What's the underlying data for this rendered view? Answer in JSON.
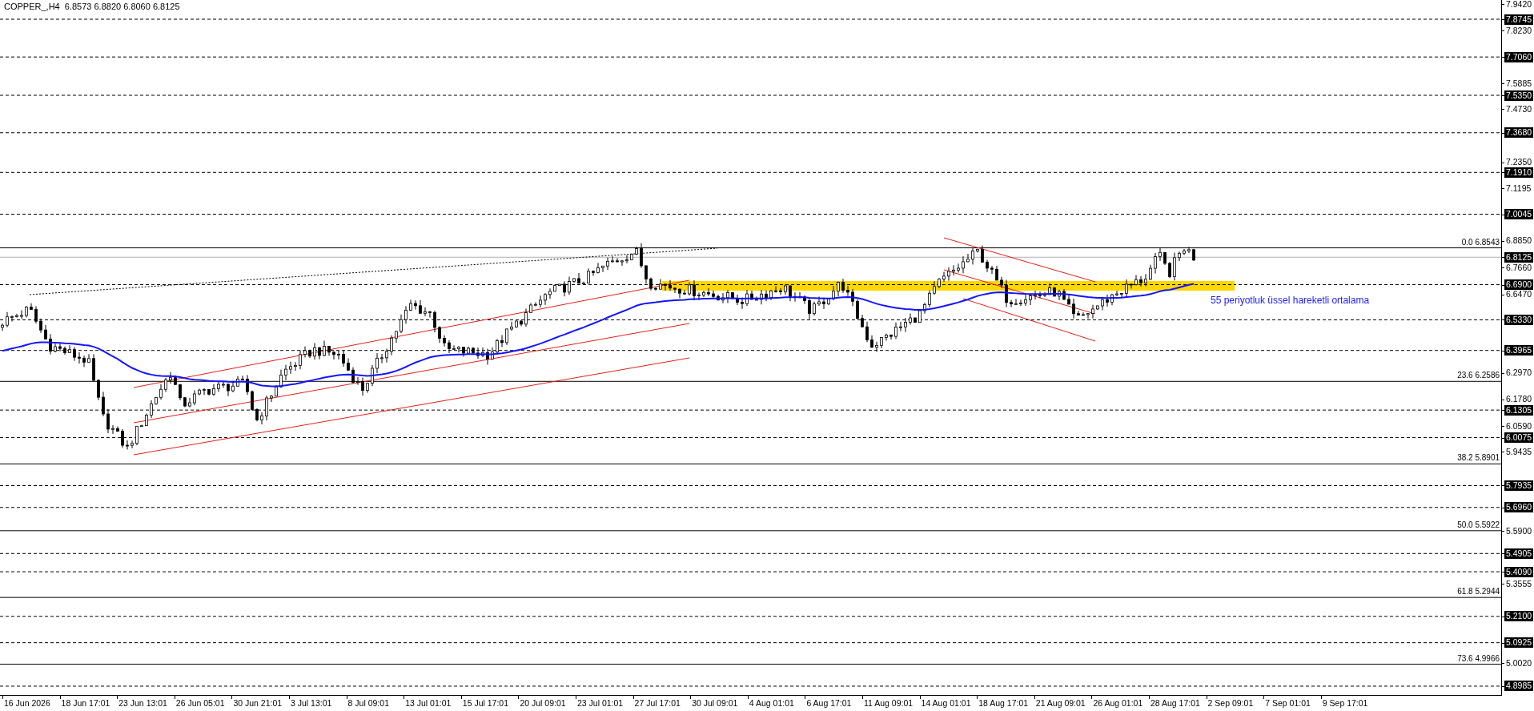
{
  "chart": {
    "title": "COPPER_,H4  6.8573 6.8820 6.8060 6.8125",
    "price_axis": [
      {
        "label": "7.9420",
        "kind": "tick"
      },
      {
        "label": "7.8745",
        "kind": "level"
      },
      {
        "label": "7.8230",
        "kind": "tick"
      },
      {
        "label": "7.7060",
        "kind": "level"
      },
      {
        "label": "7.5885",
        "kind": "tick"
      },
      {
        "label": "7.5350",
        "kind": "level"
      },
      {
        "label": "7.4730",
        "kind": "tick"
      },
      {
        "label": "7.3680",
        "kind": "level"
      },
      {
        "label": "7.2350",
        "kind": "tick"
      },
      {
        "label": "7.1910",
        "kind": "level"
      },
      {
        "label": "7.1195",
        "kind": "tick"
      },
      {
        "label": "7.0045",
        "kind": "level"
      },
      {
        "label": "6.8850",
        "kind": "tick"
      },
      {
        "label": "6.8125",
        "kind": "current"
      },
      {
        "label": "6.7660",
        "kind": "tick"
      },
      {
        "label": "6.6900",
        "kind": "level"
      },
      {
        "label": "6.6470",
        "kind": "tick"
      },
      {
        "label": "6.5330",
        "kind": "level"
      },
      {
        "label": "6.3965",
        "kind": "level"
      },
      {
        "label": "6.2970",
        "kind": "tick"
      },
      {
        "label": "6.1780",
        "kind": "tick"
      },
      {
        "label": "6.1305",
        "kind": "level"
      },
      {
        "label": "6.0590",
        "kind": "tick"
      },
      {
        "label": "6.0075",
        "kind": "level"
      },
      {
        "label": "5.9435",
        "kind": "tick"
      },
      {
        "label": "5.7935",
        "kind": "level"
      },
      {
        "label": "5.6960",
        "kind": "level"
      },
      {
        "label": "5.5900",
        "kind": "tick"
      },
      {
        "label": "5.4905",
        "kind": "level"
      },
      {
        "label": "5.4090",
        "kind": "level"
      },
      {
        "label": "5.3555",
        "kind": "tick"
      },
      {
        "label": "5.2100",
        "kind": "level"
      },
      {
        "label": "5.0925",
        "kind": "level"
      },
      {
        "label": "5.0020",
        "kind": "tick"
      },
      {
        "label": "4.8985",
        "kind": "level"
      }
    ],
    "fib_levels": [
      {
        "label": "0.0 6.8543"
      },
      {
        "label": "23.6 6.2586"
      },
      {
        "label": "38.2 5.8901"
      },
      {
        "label": "50.0 5.5922"
      },
      {
        "label": "61.8 5.2944"
      },
      {
        "label": "73.6 4.9966"
      }
    ],
    "annotation": "55 periyotluk üssel hareketli ortalama",
    "time_axis": [
      "16 Jun 2026",
      "18 Jun 17:01",
      "23 Jun 13:01",
      "26 Jun 05:01",
      "30 Jun 21:01",
      "3 Jul 13:01",
      "8 Jul 09:01",
      "13 Jul 01:01",
      "15 Jul 17:01",
      "20 Jul 09:01",
      "23 Jul 01:01",
      "27 Jul 17:01",
      "30 Jul 09:01",
      "4 Aug 01:01",
      "6 Aug 17:01",
      "11 Aug 09:01",
      "14 Aug 01:01",
      "18 Aug 17:01",
      "21 Aug 09:01",
      "26 Aug 01:01",
      "28 Aug 17:01",
      "2 Sep 09:01",
      "7 Sep 01:01",
      "9 Sep 17:01"
    ]
  }
}
